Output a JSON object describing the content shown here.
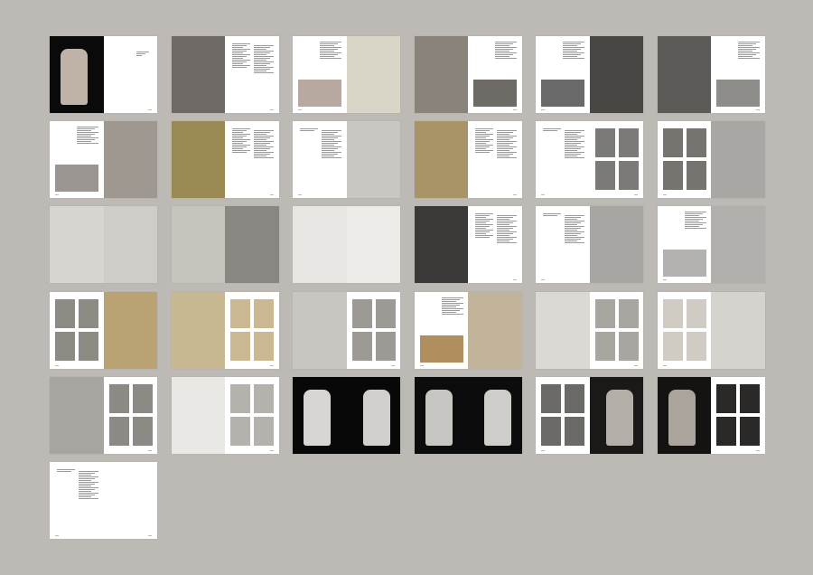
{
  "colors": {
    "background": "#bdbab5",
    "paper": "#ffffff"
  },
  "spreads": [
    [
      {
        "kind": "full",
        "bg": "#0a0a0a",
        "photo": "#bfb2a6"
      },
      {
        "kind": "title"
      }
    ],
    [
      {
        "kind": "full",
        "bg": "#6f6a66"
      },
      {
        "kind": "text"
      }
    ],
    [
      {
        "kind": "text-photo",
        "photo": "#b8a9a0"
      },
      {
        "kind": "full",
        "bg": "#d9d6c8"
      }
    ],
    [
      {
        "kind": "full",
        "bg": "#8a8379"
      },
      {
        "kind": "text-photo",
        "photo": "#6e6a66"
      }
    ],
    [
      {
        "kind": "text-photo",
        "photo": "#6a6a6a"
      },
      {
        "kind": "full",
        "bg": "#4a4643"
      }
    ],
    [
      {
        "kind": "full",
        "bg": "#5c5a56"
      },
      {
        "kind": "text-photo",
        "photo": "#8f8d8a"
      }
    ],
    [
      {
        "kind": "text-photo",
        "photo": "#9a9590"
      },
      {
        "kind": "full",
        "bg": "#9e9890"
      }
    ],
    [
      {
        "kind": "full",
        "bg": "#9c8a55"
      },
      {
        "kind": "text"
      }
    ],
    [
      {
        "kind": "text"
      },
      {
        "kind": "full",
        "bg": "#c9c7c2"
      }
    ],
    [
      {
        "kind": "full",
        "bg": "#a89466"
      },
      {
        "kind": "text"
      }
    ],
    [
      {
        "kind": "text"
      },
      {
        "kind": "grid",
        "photo": "#7c7a77"
      }
    ],
    [
      {
        "kind": "grid",
        "photo": "#777470"
      },
      {
        "kind": "full",
        "bg": "#a9a7a4"
      }
    ],
    [
      {
        "kind": "full",
        "bg": "#d8d5d0"
      },
      {
        "kind": "full",
        "bg": "#d0cdc8"
      }
    ],
    [
      {
        "kind": "full",
        "bg": "#c7c4be"
      },
      {
        "kind": "full",
        "bg": "#8a8682"
      }
    ],
    [
      {
        "kind": "full",
        "bg": "#e8e6e2"
      },
      {
        "kind": "full",
        "bg": "#ecebe8"
      }
    ],
    [
      {
        "kind": "full",
        "bg": "#3c3a38"
      },
      {
        "kind": "text"
      }
    ],
    [
      {
        "kind": "text"
      },
      {
        "kind": "full",
        "bg": "#a8a6a2"
      }
    ],
    [
      {
        "kind": "text-photo",
        "photo": "#b4b2ae"
      },
      {
        "kind": "full",
        "bg": "#b2b0ac"
      }
    ],
    [
      {
        "kind": "grid",
        "photo": "#8e8a84"
      },
      {
        "kind": "full",
        "bg": "#b9a373"
      }
    ],
    [
      {
        "kind": "full",
        "bg": "#c7b891"
      },
      {
        "kind": "grid",
        "photo": "#c9b892"
      }
    ],
    [
      {
        "kind": "full",
        "bg": "#c9c6c1"
      },
      {
        "kind": "grid",
        "photo": "#9d9a96"
      }
    ],
    [
      {
        "kind": "text-photo",
        "photo": "#b08f5e"
      },
      {
        "kind": "full",
        "bg": "#c2b49a"
      }
    ],
    [
      {
        "kind": "full",
        "bg": "#dcd9d4"
      },
      {
        "kind": "grid",
        "photo": "#a9a6a1"
      }
    ],
    [
      {
        "kind": "grid",
        "photo": "#d0ccc4"
      },
      {
        "kind": "full",
        "bg": "#d6d3ce"
      }
    ],
    [
      {
        "kind": "full",
        "bg": "#a8a5a0"
      },
      {
        "kind": "grid",
        "photo": "#8d8a86"
      }
    ],
    [
      {
        "kind": "full",
        "bg": "#e9e8e5"
      },
      {
        "kind": "grid",
        "photo": "#b5b2ad"
      }
    ],
    [
      {
        "kind": "full",
        "bg": "#080808",
        "photo": "#d8d6d2"
      },
      {
        "kind": "full",
        "bg": "#080808",
        "photo": "#d2d0cc"
      }
    ],
    [
      {
        "kind": "full",
        "bg": "#0c0c0c",
        "photo": "#c8c6c2"
      },
      {
        "kind": "full",
        "bg": "#0c0c0c",
        "photo": "#cfcdc9"
      }
    ],
    [
      {
        "kind": "grid",
        "photo": "#6c6a67"
      },
      {
        "kind": "full",
        "bg": "#1a1918",
        "photo": "#b3aea8"
      }
    ],
    [
      {
        "kind": "full",
        "bg": "#141312",
        "photo": "#aaa49d"
      },
      {
        "kind": "grid",
        "photo": "#2b2927"
      }
    ],
    [
      {
        "kind": "text"
      },
      {
        "kind": "blank"
      }
    ]
  ]
}
